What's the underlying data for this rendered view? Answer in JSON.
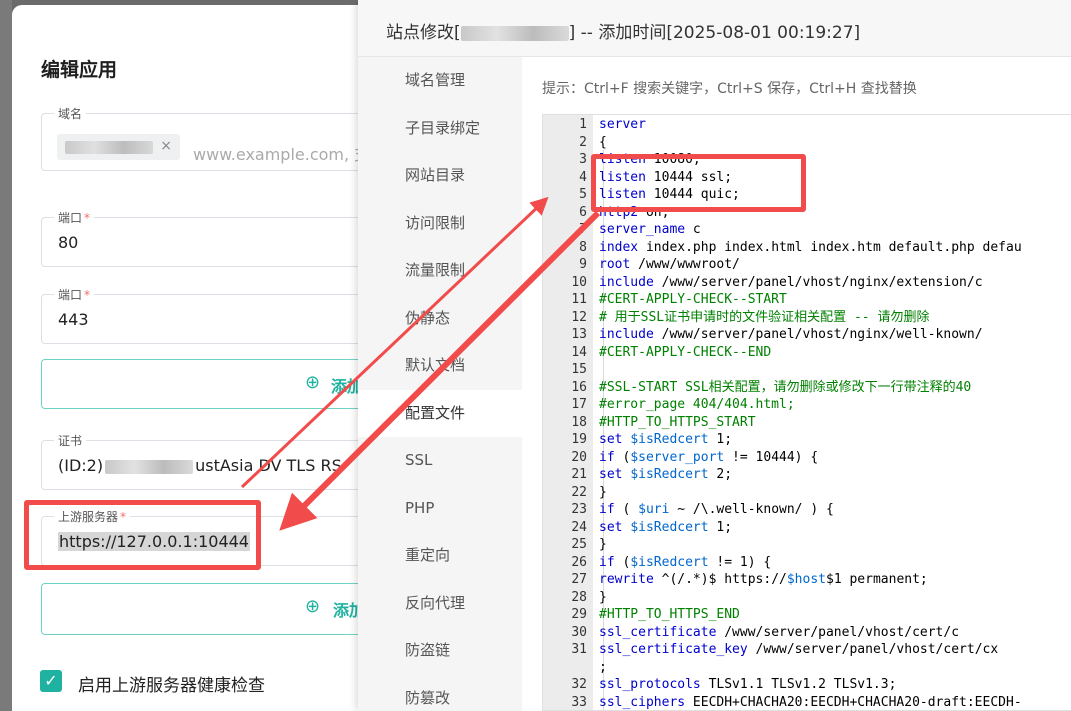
{
  "left_dialog": {
    "title": "编辑应用",
    "domain_field": {
      "label": "域名",
      "tag_close": "×",
      "placeholder": "www.example.com, 支"
    },
    "port1": {
      "label": "端口",
      "required": "*",
      "value": "80"
    },
    "port2": {
      "label": "端口",
      "required": "*",
      "value": "443"
    },
    "add_button_1": {
      "icon": "plus-circle-icon",
      "label": "添加"
    },
    "cert": {
      "label": "证书",
      "value_prefix": "(ID:2)",
      "value_suffix": "ustAsia DV TLS RS"
    },
    "upstream": {
      "label": "上游服务器",
      "required": "*",
      "value": "https://127.0.0.1:10444"
    },
    "add_button_2": {
      "icon": "plus-circle-icon",
      "label": "添加"
    },
    "health_check": {
      "checked": true,
      "label": "启用上游服务器健康检查"
    }
  },
  "right_dialog": {
    "title_prefix": "站点修改[",
    "title_suffix": "] -- 添加时间[2025-08-01 00:19:27]",
    "nav": [
      "域名管理",
      "子目录绑定",
      "网站目录",
      "访问限制",
      "流量限制",
      "伪静态",
      "默认文档",
      "配置文件",
      "SSL",
      "PHP",
      "重定向",
      "反向代理",
      "防盗链",
      "防篡改"
    ],
    "active_nav": "配置文件",
    "tip": "提示：Ctrl+F 搜索关键字，Ctrl+S 保存，Ctrl+H 查找替换",
    "code": [
      {
        "n": "1",
        "t": "server"
      },
      {
        "n": "2",
        "t": "{"
      },
      {
        "n": "3",
        "t": "    listen 10080;"
      },
      {
        "n": "4",
        "t": "    listen 10444 ssl;"
      },
      {
        "n": "5",
        "t": "    listen 10444 quic;"
      },
      {
        "n": "6",
        "t": "    http2 on;"
      },
      {
        "n": "7",
        "t": "    server_name c"
      },
      {
        "n": "8",
        "t": "    index index.php index.html index.htm default.php defau"
      },
      {
        "n": "9",
        "t": "    root /www/wwwroot/"
      },
      {
        "n": "10",
        "t": "    include /www/server/panel/vhost/nginx/extension/c"
      },
      {
        "n": "11",
        "t": "    #CERT-APPLY-CHECK--START"
      },
      {
        "n": "12",
        "t": "    # 用于SSL证书申请时的文件验证相关配置 -- 请勿删除"
      },
      {
        "n": "13",
        "t": "    include /www/server/panel/vhost/nginx/well-known/"
      },
      {
        "n": "14",
        "t": "    #CERT-APPLY-CHECK--END"
      },
      {
        "n": "15",
        "t": ""
      },
      {
        "n": "16",
        "t": "    #SSL-START SSL相关配置，请勿删除或修改下一行带注释的40"
      },
      {
        "n": "17",
        "t": "    #error_page 404/404.html;"
      },
      {
        "n": "18",
        "t": "    #HTTP_TO_HTTPS_START"
      },
      {
        "n": "19",
        "t": "    set $isRedcert 1;"
      },
      {
        "n": "20",
        "t": "    if ($server_port != 10444) {"
      },
      {
        "n": "21",
        "t": "        set $isRedcert 2;"
      },
      {
        "n": "22",
        "t": "    }"
      },
      {
        "n": "23",
        "t": "    if ( $uri ~ /\\.well-known/ ) {"
      },
      {
        "n": "24",
        "t": "        set $isRedcert 1;"
      },
      {
        "n": "25",
        "t": "    }"
      },
      {
        "n": "26",
        "t": "    if ($isRedcert != 1) {"
      },
      {
        "n": "27",
        "t": "        rewrite ^(/.*)$ https://$host$1 permanent;"
      },
      {
        "n": "28",
        "t": "    }"
      },
      {
        "n": "29",
        "t": "    #HTTP_TO_HTTPS_END"
      },
      {
        "n": "30",
        "t": "    ssl_certificate    /www/server/panel/vhost/cert/c"
      },
      {
        "n": "31",
        "t": "    ssl_certificate_key    /www/server/panel/vhost/cert/cx"
      },
      {
        "n": "",
        "t": "      ;"
      },
      {
        "n": "32",
        "t": "    ssl_protocols TLSv1.1 TLSv1.2 TLSv1.3;"
      },
      {
        "n": "33",
        "t": "    ssl_ciphers EECDH+CHACHA20:EECDH+CHACHA20-draft:EECDH-"
      }
    ]
  },
  "colors": {
    "accent": "#20b2a0",
    "annotation": "#f24b4b",
    "comment": "#008000",
    "keyword": "#0000cd"
  }
}
